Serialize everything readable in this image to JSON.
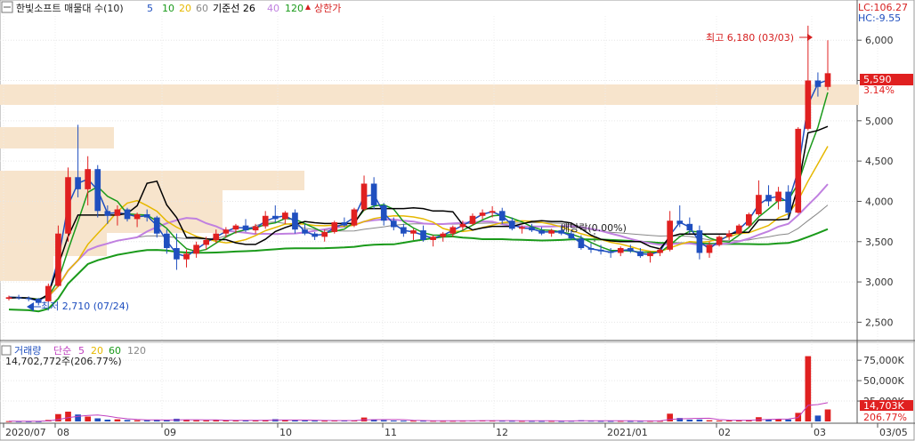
{
  "legend": {
    "stock_title": "한빛소프트 매물대 수(10)",
    "ma_periods": [
      {
        "label": "5",
        "color": "#1f4fbf"
      },
      {
        "label": "10",
        "color": "#1a9a1a"
      },
      {
        "label": "20",
        "color": "#e6b800"
      },
      {
        "label": "60",
        "color": "#888888"
      },
      {
        "label": "기준선 26",
        "color": "#000000"
      },
      {
        "label": "40",
        "color": "#c080e0"
      },
      {
        "label": "120",
        "color": "#1a9a1a"
      }
    ],
    "upper_limit_label": "상한가",
    "upper_limit_color": "#d62020"
  },
  "corner": {
    "lc": "LC:106.27",
    "hc": "HC:-9.55"
  },
  "annotations": {
    "high": "최고 6,180 (03/03)",
    "low": "최저 2,710 (07/24)",
    "dividend": "배당락(0.00%)"
  },
  "price_tag": {
    "value": "5,590",
    "change": "3.14%"
  },
  "volume_legend": {
    "title": "거래량",
    "simple": "단순",
    "periods": [
      {
        "label": "5",
        "color": "#c040c0"
      },
      {
        "label": "20",
        "color": "#e6b800"
      },
      {
        "label": "60",
        "color": "#1a9a1a"
      },
      {
        "label": "120",
        "color": "#888888"
      }
    ],
    "info": "14,702,772주(206.77%)"
  },
  "volume_tag": {
    "value": "14,703K",
    "pct": "206.77%"
  },
  "colors": {
    "up": "#e02020",
    "down": "#1f4fbf",
    "band": "#f7e4cc"
  },
  "chart_data": [
    {
      "type": "candlestick",
      "title": "한빛소프트 매물대 수(10)",
      "ylim": [
        2350,
        6300
      ],
      "y_ticks": [
        "2,500",
        "3,000",
        "3,500",
        "4,000",
        "4,500",
        "5,000",
        "5,500",
        "6,000"
      ],
      "y_tick_values": [
        2500,
        3000,
        3500,
        4000,
        4500,
        5000,
        5500,
        6000
      ],
      "x_ticks": [
        "2020/07",
        "08",
        "09",
        "10",
        "11",
        "12",
        "2021/01",
        "02",
        "03",
        "03/05"
      ],
      "high": 6180,
      "low": 2710,
      "last_close": 5590,
      "change_pct": 3.14,
      "candles": [
        [
          2790,
          2830,
          2770,
          2810
        ],
        [
          2810,
          2840,
          2780,
          2800
        ],
        [
          2800,
          2820,
          2760,
          2790
        ],
        [
          2790,
          2800,
          2710,
          2740
        ],
        [
          2760,
          2980,
          2750,
          2950
        ],
        [
          2950,
          3700,
          2940,
          3600
        ],
        [
          3600,
          4420,
          3500,
          4300
        ],
        [
          4300,
          4950,
          4050,
          4150
        ],
        [
          4150,
          4560,
          3950,
          4400
        ],
        [
          4400,
          4450,
          3800,
          3880
        ],
        [
          3880,
          3950,
          3720,
          3820
        ],
        [
          3820,
          3950,
          3700,
          3900
        ],
        [
          3900,
          3920,
          3750,
          3780
        ],
        [
          3780,
          3860,
          3680,
          3840
        ],
        [
          3840,
          3900,
          3750,
          3800
        ],
        [
          3800,
          3820,
          3550,
          3600
        ],
        [
          3600,
          3650,
          3350,
          3420
        ],
        [
          3420,
          3600,
          3150,
          3280
        ],
        [
          3280,
          3400,
          3180,
          3350
        ],
        [
          3350,
          3500,
          3300,
          3460
        ],
        [
          3460,
          3560,
          3400,
          3520
        ],
        [
          3520,
          3650,
          3480,
          3600
        ],
        [
          3600,
          3680,
          3550,
          3650
        ],
        [
          3650,
          3720,
          3600,
          3700
        ],
        [
          3700,
          3780,
          3620,
          3640
        ],
        [
          3640,
          3720,
          3600,
          3690
        ],
        [
          3690,
          3880,
          3660,
          3820
        ],
        [
          3820,
          3950,
          3740,
          3780
        ],
        [
          3780,
          3880,
          3720,
          3860
        ],
        [
          3860,
          3900,
          3600,
          3650
        ],
        [
          3650,
          3720,
          3580,
          3600
        ],
        [
          3600,
          3620,
          3520,
          3560
        ],
        [
          3560,
          3650,
          3500,
          3620
        ],
        [
          3620,
          3760,
          3600,
          3740
        ],
        [
          3740,
          3800,
          3680,
          3700
        ],
        [
          3700,
          3920,
          3680,
          3900
        ],
        [
          3900,
          4320,
          3880,
          4220
        ],
        [
          4220,
          4300,
          3900,
          3950
        ],
        [
          3950,
          3980,
          3700,
          3760
        ],
        [
          3760,
          3800,
          3640,
          3680
        ],
        [
          3680,
          3720,
          3560,
          3600
        ],
        [
          3600,
          3660,
          3520,
          3640
        ],
        [
          3640,
          3700,
          3500,
          3520
        ],
        [
          3520,
          3580,
          3440,
          3560
        ],
        [
          3560,
          3620,
          3500,
          3600
        ],
        [
          3600,
          3700,
          3560,
          3680
        ],
        [
          3680,
          3760,
          3640,
          3720
        ],
        [
          3720,
          3850,
          3700,
          3820
        ],
        [
          3820,
          3900,
          3780,
          3860
        ],
        [
          3860,
          3940,
          3800,
          3880
        ],
        [
          3880,
          3920,
          3720,
          3760
        ],
        [
          3760,
          3800,
          3640,
          3660
        ],
        [
          3660,
          3700,
          3600,
          3680
        ],
        [
          3680,
          3720,
          3620,
          3640
        ],
        [
          3640,
          3680,
          3580,
          3600
        ],
        [
          3600,
          3660,
          3560,
          3640
        ],
        [
          3640,
          3700,
          3580,
          3600
        ],
        [
          3600,
          3640,
          3520,
          3540
        ],
        [
          3540,
          3580,
          3400,
          3420
        ],
        [
          3420,
          3480,
          3360,
          3400
        ],
        [
          3400,
          3460,
          3340,
          3380
        ],
        [
          3380,
          3420,
          3300,
          3360
        ],
        [
          3360,
          3440,
          3320,
          3420
        ],
        [
          3420,
          3460,
          3360,
          3380
        ],
        [
          3380,
          3420,
          3300,
          3320
        ],
        [
          3320,
          3380,
          3240,
          3360
        ],
        [
          3360,
          3420,
          3320,
          3400
        ],
        [
          3400,
          3880,
          3380,
          3760
        ],
        [
          3760,
          3950,
          3680,
          3720
        ],
        [
          3720,
          3800,
          3600,
          3640
        ],
        [
          3640,
          3700,
          3280,
          3360
        ],
        [
          3360,
          3500,
          3300,
          3460
        ],
        [
          3460,
          3580,
          3440,
          3560
        ],
        [
          3560,
          3640,
          3520,
          3600
        ],
        [
          3600,
          3720,
          3580,
          3700
        ],
        [
          3700,
          3860,
          3680,
          3840
        ],
        [
          3840,
          4260,
          3820,
          4080
        ],
        [
          4080,
          4200,
          3940,
          4000
        ],
        [
          4000,
          4180,
          3900,
          4120
        ],
        [
          4120,
          4200,
          3800,
          3860
        ],
        [
          3860,
          4920,
          3850,
          4900
        ],
        [
          4900,
          6180,
          4880,
          5500
        ],
        [
          5500,
          5600,
          5300,
          5420
        ],
        [
          5420,
          6000,
          5380,
          5590
        ]
      ]
    },
    {
      "type": "bar",
      "title": "거래량",
      "ylim": [
        0,
        85000
      ],
      "y_ticks": [
        "25,000K",
        "50,000K",
        "75,000K"
      ],
      "y_tick_values": [
        25000,
        50000,
        75000
      ],
      "unit": "K",
      "last_value": 14703,
      "last_pct": 206.77,
      "values": [
        400,
        300,
        250,
        280,
        1800,
        9000,
        12000,
        8500,
        6000,
        3800,
        2200,
        2600,
        1800,
        1500,
        1400,
        1700,
        2100,
        3300,
        1900,
        1400,
        1300,
        1600,
        1200,
        1300,
        1500,
        1100,
        1800,
        2800,
        1600,
        1400,
        1100,
        900,
        900,
        1300,
        1100,
        1400,
        4800,
        2400,
        1500,
        1100,
        900,
        800,
        900,
        800,
        700,
        800,
        900,
        1100,
        1200,
        1000,
        900,
        800,
        700,
        700,
        650,
        700,
        600,
        800,
        1400,
        900,
        700,
        650,
        700,
        600,
        650,
        700,
        700,
        9500,
        4200,
        2200,
        2400,
        1500,
        1100,
        1100,
        1300,
        1900,
        5200,
        2600,
        3200,
        2400,
        10500,
        80000,
        7200,
        14703
      ]
    }
  ]
}
